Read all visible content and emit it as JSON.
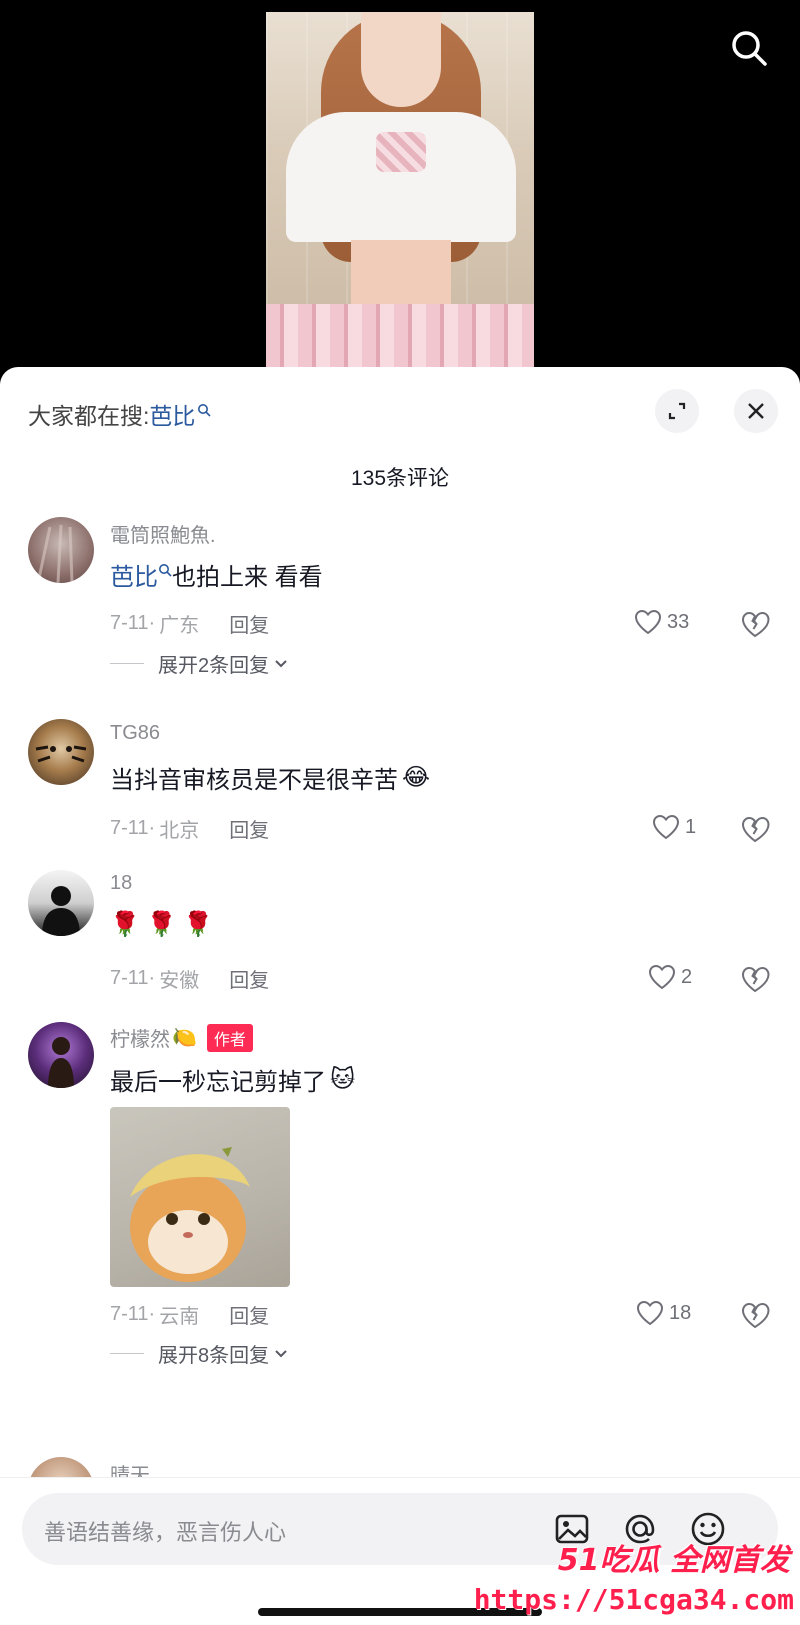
{
  "hot_search": {
    "prefix": "大家都在搜:",
    "term": "芭比"
  },
  "comment_count": "135条评论",
  "comments": [
    {
      "username": "電筒照鮑魚.",
      "link_text": "芭比",
      "text": "也拍上来 看看",
      "date": "7-11",
      "location": "广东",
      "reply": "回复",
      "likes": "33",
      "expand": "展开2条回复"
    },
    {
      "username": "TG86",
      "text": "当抖音审核员是不是很辛苦",
      "emoji": "😂",
      "date": "7-11",
      "location": "北京",
      "reply": "回复",
      "likes": "1"
    },
    {
      "username": "18",
      "text": "🌹 🌹 🌹",
      "date": "7-11",
      "location": "安徽",
      "reply": "回复",
      "likes": "2"
    },
    {
      "username": "柠檬然",
      "username_emoji": "🍋",
      "badge": "作者",
      "text": "最后一秒忘记剪掉了",
      "emoji": "🐱",
      "date": "7-11",
      "location": "云南",
      "reply": "回复",
      "likes": "18",
      "expand": "展开8条回复"
    },
    {
      "username": "晴天"
    }
  ],
  "input": {
    "placeholder": "善语结善缘，恶言伤人心"
  },
  "watermark": {
    "line1": "51吃瓜 全网首发",
    "line2": "https://51cga34.com"
  },
  "colors": {
    "accent_link": "#2b5a9f",
    "badge": "#fe2c55",
    "watermark": "#ff1f4d"
  },
  "icons": [
    "search-icon",
    "expand-icon",
    "close-icon",
    "heart-icon",
    "broken-heart-icon",
    "chevron-down-icon",
    "image-icon",
    "at-icon",
    "emoji-icon"
  ]
}
